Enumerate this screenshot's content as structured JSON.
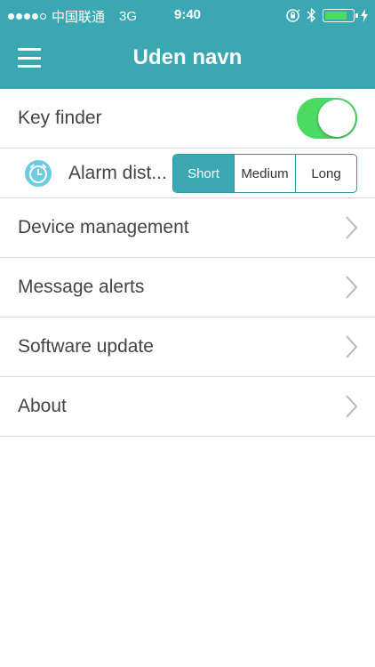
{
  "status_bar": {
    "carrier": "中国联通",
    "network": "3G",
    "time": "9:40",
    "signal_dots_filled": 4,
    "signal_dots_total": 5,
    "battery_level": 0.75,
    "icons": [
      "orientation-lock-icon",
      "bluetooth-icon",
      "battery-icon",
      "charging-icon"
    ]
  },
  "nav": {
    "title": "Uden navn",
    "menu_icon": "hamburger-menu-icon"
  },
  "key_finder": {
    "label": "Key finder",
    "enabled": true
  },
  "alarm_distance": {
    "label": "Alarm dist...",
    "icon": "alarm-clock-icon",
    "options": [
      "Short",
      "Medium",
      "Long"
    ],
    "selected": "Short"
  },
  "menu_items": [
    {
      "label": "Device management"
    },
    {
      "label": "Message alerts"
    },
    {
      "label": "Software update"
    },
    {
      "label": "About"
    }
  ],
  "colors": {
    "accent": "#3aa7b2",
    "toggle_on": "#4cd964",
    "text": "#444444"
  }
}
